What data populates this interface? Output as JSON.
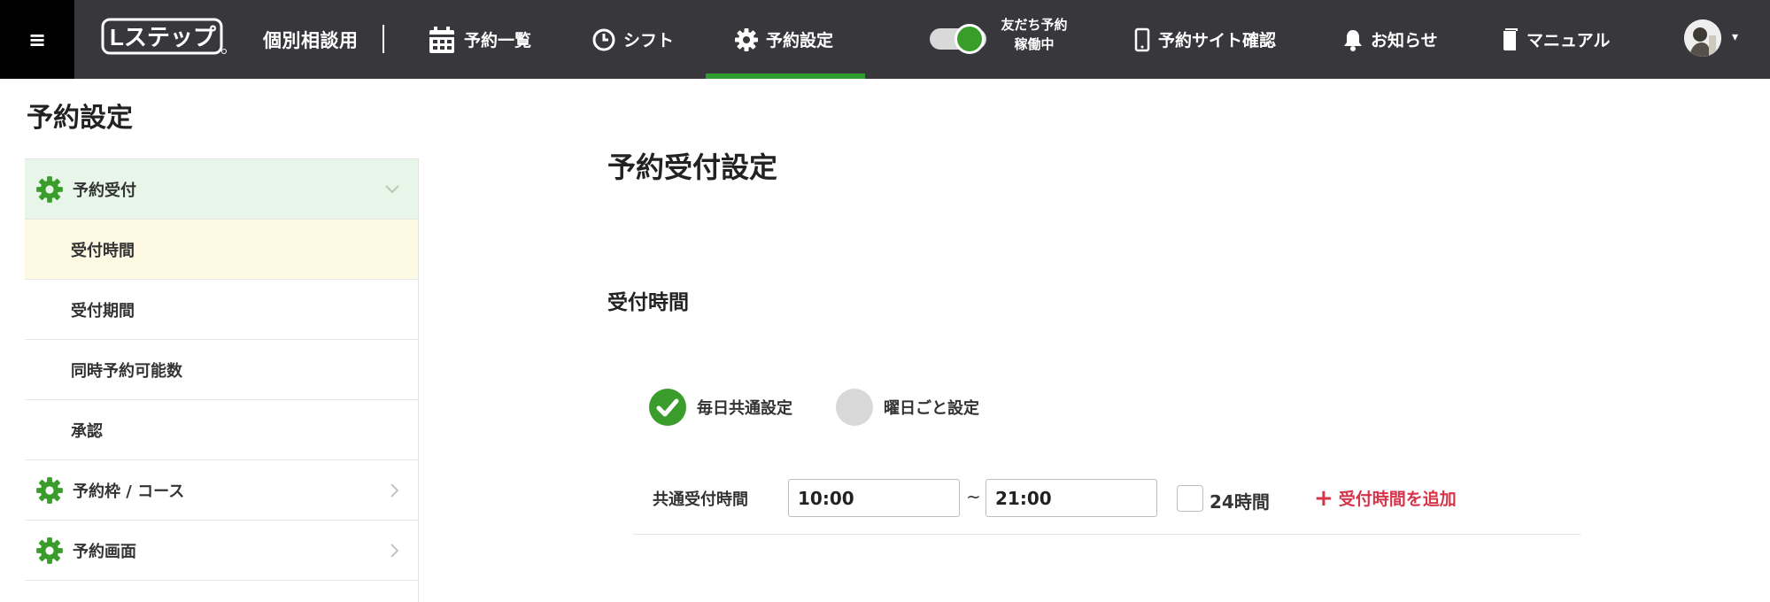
{
  "app": {
    "menu_glyph": "≡",
    "logo_text": "Lステップ",
    "account_name": "個別相談用"
  },
  "nav": {
    "items": [
      {
        "label": "予約一覧",
        "icon": "calendar-icon"
      },
      {
        "label": "シフト",
        "icon": "clock-icon"
      },
      {
        "label": "予約設定",
        "icon": "gear-icon",
        "active": true
      }
    ],
    "toggle_label_line1": "友だち予約",
    "toggle_label_line2": "稼働中",
    "toggle_on": true,
    "right_items": [
      {
        "label": "予約サイト確認",
        "icon": "smartphone-icon"
      },
      {
        "label": "お知らせ",
        "icon": "bell-icon"
      },
      {
        "label": "マニュアル",
        "icon": "book-icon"
      }
    ]
  },
  "page": {
    "title": "予約設定"
  },
  "sidebar": {
    "groups": [
      {
        "label": "予約受付",
        "expanded": true,
        "items": [
          {
            "label": "受付時間",
            "selected": true
          },
          {
            "label": "受付期間"
          },
          {
            "label": "同時予約可能数"
          },
          {
            "label": "承認"
          }
        ]
      },
      {
        "label": "予約枠 / コース",
        "expanded": false
      },
      {
        "label": "予約画面",
        "expanded": false
      }
    ]
  },
  "main": {
    "title": "予約受付設定",
    "section_title": "受付時間",
    "radio_options": [
      {
        "label": "毎日共通設定",
        "checked": true
      },
      {
        "label": "曜日ごと設定",
        "checked": false
      }
    ],
    "field_label": "共通受付時間",
    "start_time": "10:00",
    "range_separator": "~",
    "end_time": "21:00",
    "checkbox_label": "24時間",
    "checkbox_checked": false,
    "add_link_label": "受付時間を追加"
  },
  "colors": {
    "topbar_bg": "#38383c",
    "brand_green": "#3a9c2b",
    "active_underline": "#2f9e2f",
    "sidebar_open_bg": "#e8f5e9",
    "sidebar_selected_bg": "#fdf9e3",
    "add_link_red": "#d6344b"
  }
}
